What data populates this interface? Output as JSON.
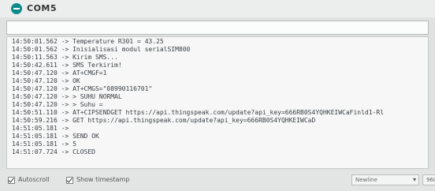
{
  "window": {
    "title": "COM5"
  },
  "send": {
    "value": ""
  },
  "console": {
    "lines": [
      "14:50:01.562 -> Temperature R301 = 43.25",
      "14:50:01.562 -> Inisialisasi modul serialSIM800",
      "14:50:11.563 -> Kirim SMS...",
      "14:50:42.611 -> SMS Terkirim!",
      "14:50:47.120 -> AT+CMGF=1",
      "14:50:47.120 -> OK",
      "14:50:47.120 -> AT+CMGS=\"08990116701\"",
      "14:50:47.120 -> > SUHU NORMAL",
      "14:50:47.120 -> > Suhu =",
      "14:50:51.110 -> AT+CIPSENDGET https://api.thingspeak.com/update?api_key=666RB0S4YQHKEIWCaFinld1-Rl",
      "14:50:59.216 -> GET https://api.thingspeak.com/update?api_key=666RB0S4YQHKEIWCaD",
      "14:51:05.181 ->",
      "14:51:05.181 -> SEND OK",
      "14:51:05.181 -> 5",
      "14:51:07.724 -> CLOSED"
    ]
  },
  "status": {
    "autoscroll": "Autoscroll",
    "autoscroll_checked": true,
    "timestamp": "Show timestamp",
    "timestamp_checked": true,
    "line_ending": "Newline",
    "baud": "960"
  }
}
